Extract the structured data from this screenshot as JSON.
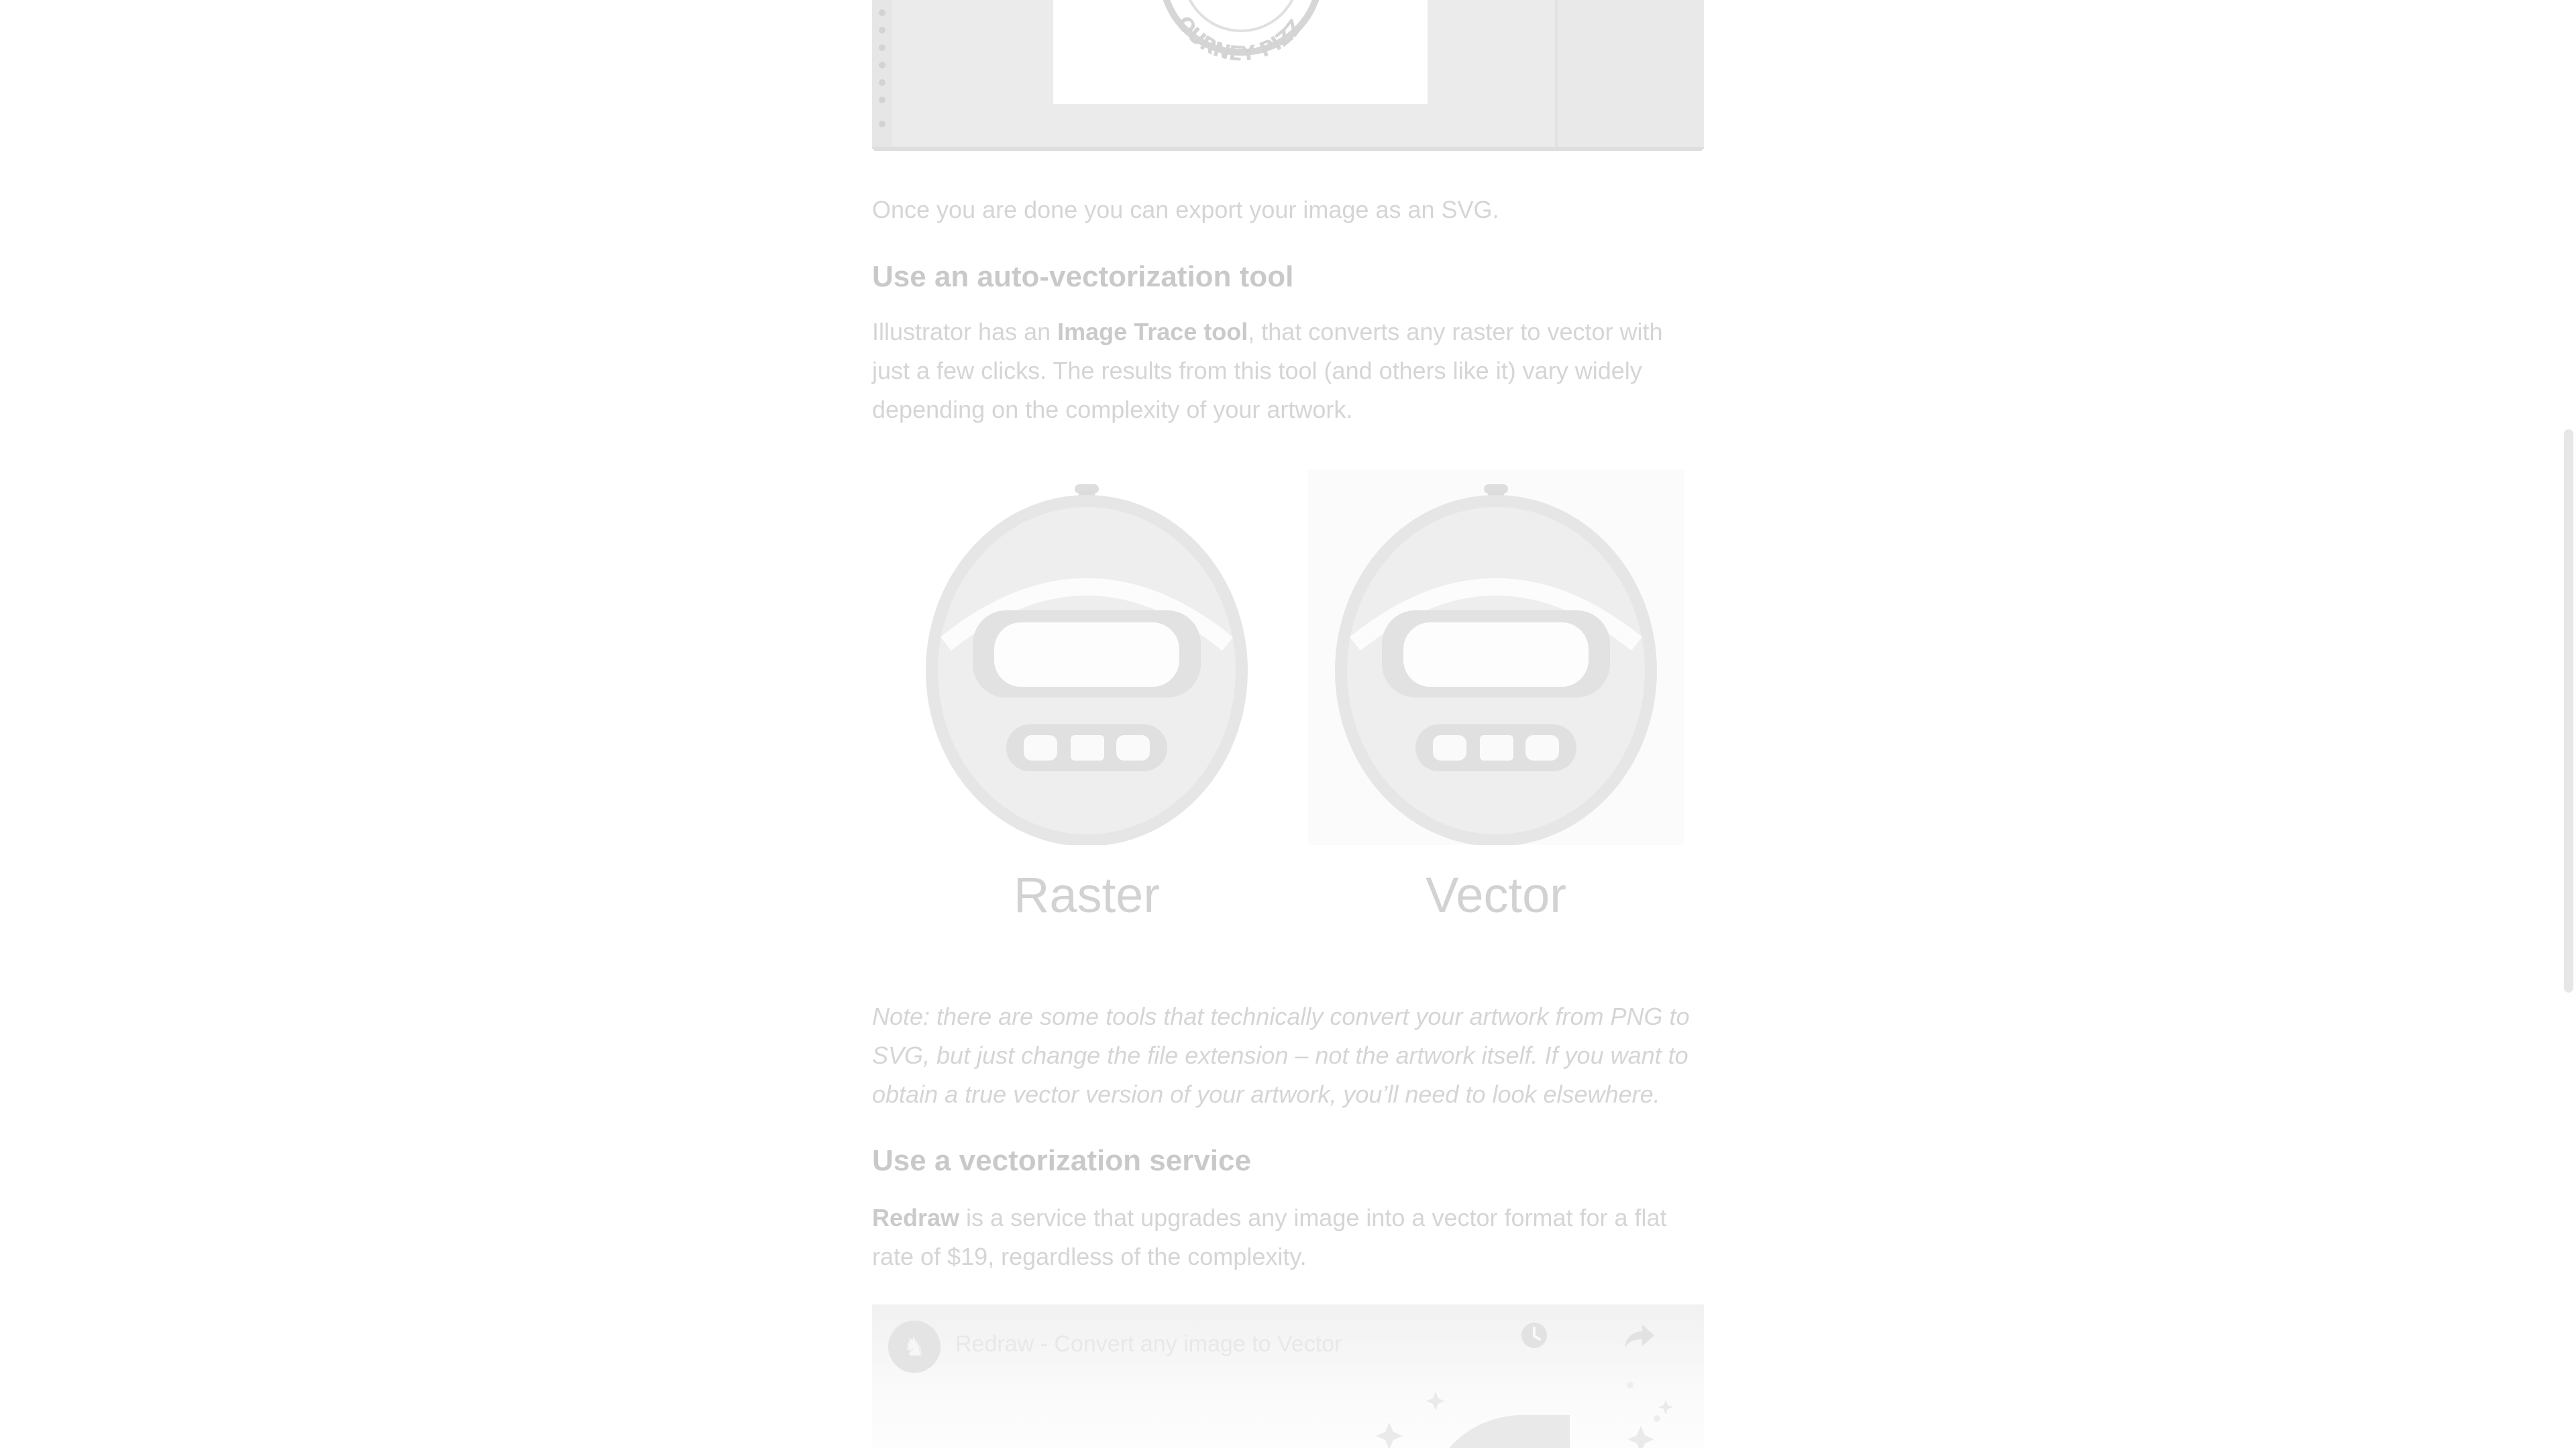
{
  "article": {
    "export_text": "Once you are done you can export your image as an SVG.",
    "heading_auto": "Use an auto-vectorization tool",
    "auto_para": {
      "before": "Illustrator has an ",
      "link": "Image Trace tool",
      "after": ", that converts any raster to vector with just a few clicks. The results from this tool (and others like it) vary widely depending on the complexity of your artwork."
    },
    "comparison": {
      "left_label": "Raster",
      "right_label": "Vector"
    },
    "note": "Note: there are some tools that technically convert your artwork from PNG to SVG, but just change the file extension – not the artwork itself. If you want to obtain a true vector version of your artwork, you’ll need to look elsewhere.",
    "heading_service": "Use a vectorization service",
    "service_para": {
      "link": "Redraw",
      "after": " is a service that upgrades any image into a vector format for a flat rate of $19, regardless of the complexity."
    },
    "top_image_logo_text": "OURNEY PIZZ"
  },
  "video": {
    "title": "Redraw - Convert any image to Vector",
    "avatar_icon": "horse-icon",
    "watch_later_icon": "clock-icon",
    "share_icon": "share-arrow-icon"
  }
}
